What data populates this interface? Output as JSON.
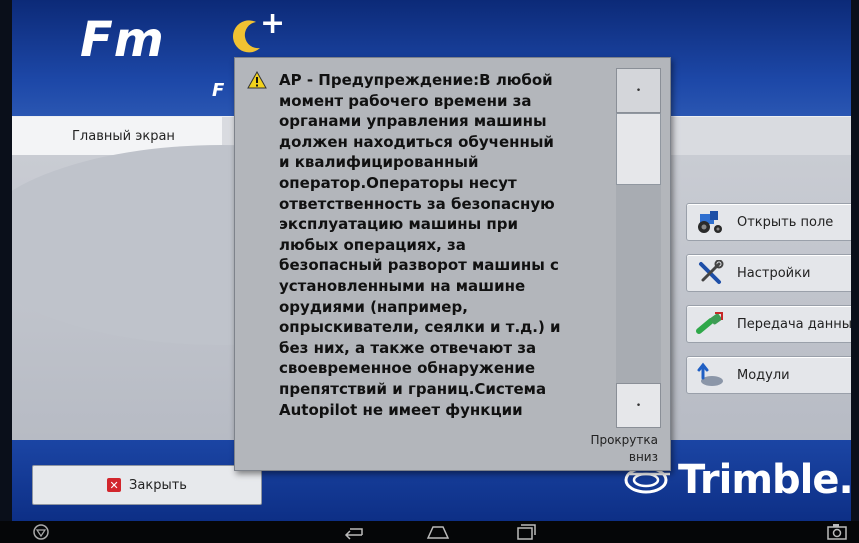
{
  "app": {
    "logo_text": "Fm",
    "logo_plus": "+",
    "logo_sub": "F"
  },
  "tab": {
    "label": "Главный экран"
  },
  "side_buttons": [
    {
      "label": "Открыть поле",
      "icon": "tractor-icon"
    },
    {
      "label": "Настройки",
      "icon": "wrench-screwdriver-icon"
    },
    {
      "label": "Передача данных",
      "icon": "data-transfer-icon"
    },
    {
      "label": "Модули",
      "icon": "modules-icon"
    }
  ],
  "footer": {
    "close_label": "Закрыть",
    "brand": "Trimble."
  },
  "dialog": {
    "icon": "warning-icon",
    "message": "AP - Предупреждение:В любой\nмомент рабочего времени за\nорганами управления машины\nдолжен находиться обученный\nи квалифицированный\nоператор.Операторы несут\nответственность за безопасную\nэксплуатацию машины при\nлюбых операциях, за\nбезопасный разворот машины с\nустановленными на машине\nорудиями (например,\nопрыскиватели, сеялки и т.д.) и\nбез них, а также отвечают за\nсвоевременное обнаружение\nпрепятствий и границ.Система\nAutopilot не имеет функции",
    "scroll_hint": "Прокрутка\nвниз"
  },
  "colors": {
    "header": "#1d48a8",
    "content": "#c9ccd3",
    "dialog": "#b3b6bb",
    "close_red": "#d2262c"
  }
}
